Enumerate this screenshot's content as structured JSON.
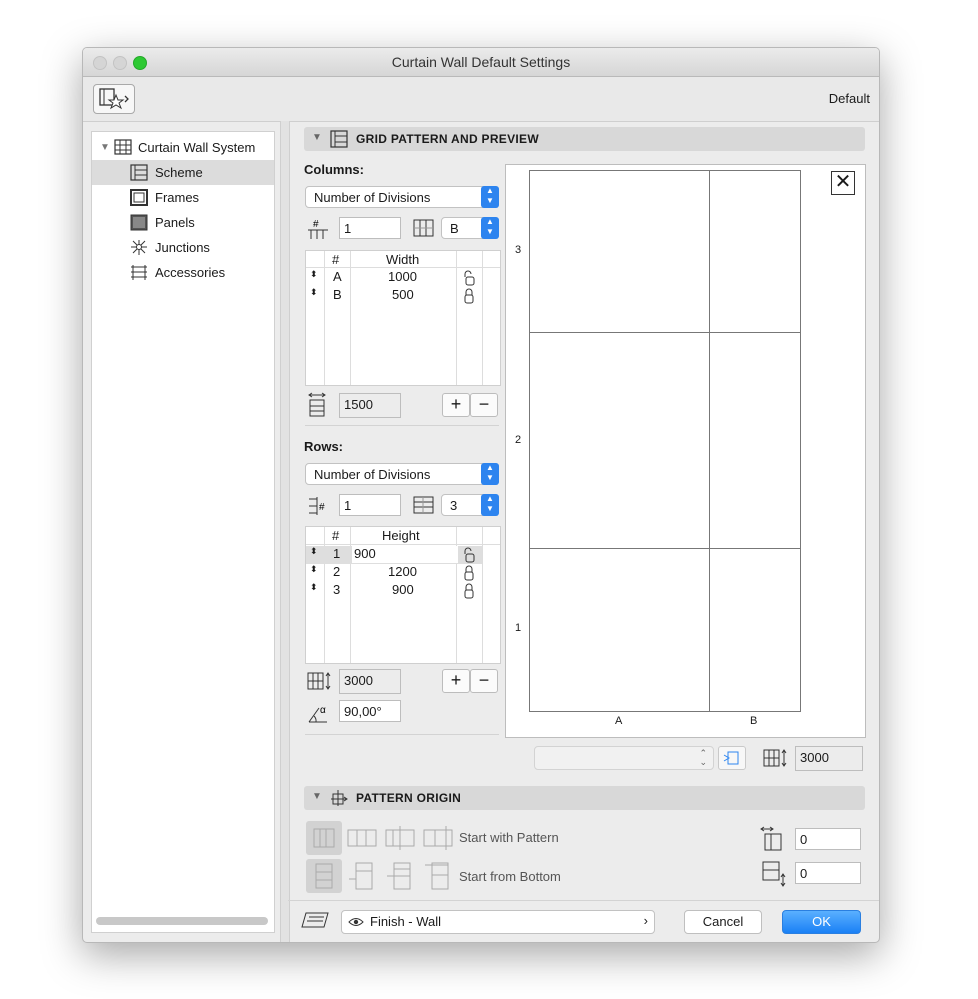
{
  "window": {
    "title": "Curtain Wall Default Settings",
    "favorites_label": "Default"
  },
  "sidebar": {
    "root": "Curtain Wall System",
    "items": [
      {
        "label": "Scheme",
        "icon": "scheme-icon",
        "selected": true
      },
      {
        "label": "Frames",
        "icon": "frames-icon"
      },
      {
        "label": "Panels",
        "icon": "panels-icon"
      },
      {
        "label": "Junctions",
        "icon": "junctions-icon"
      },
      {
        "label": "Accessories",
        "icon": "accessories-icon"
      }
    ]
  },
  "grid_section": {
    "title": "GRID PATTERN AND PREVIEW"
  },
  "columns": {
    "label": "Columns:",
    "mode": "Number of Divisions",
    "count": "1",
    "pattern": "B",
    "headers": [
      "#",
      "Width"
    ],
    "rows": [
      {
        "id": "A",
        "value": "1000",
        "lock": "unlocked"
      },
      {
        "id": "B",
        "value": "500",
        "lock": "locked"
      }
    ],
    "total": "1500"
  },
  "rows": {
    "label": "Rows:",
    "mode": "Number of Divisions",
    "count": "1",
    "pattern": "3",
    "headers": [
      "#",
      "Height"
    ],
    "rows": [
      {
        "id": "1",
        "value": "900",
        "lock": "unlocked",
        "editing": true
      },
      {
        "id": "2",
        "value": "1200",
        "lock": "locked"
      },
      {
        "id": "3",
        "value": "900",
        "lock": "locked"
      }
    ],
    "total": "3000",
    "angle": "90,00°"
  },
  "preview": {
    "row_labels": [
      "3",
      "2",
      "1"
    ],
    "col_labels": [
      "A",
      "B"
    ],
    "height_value": "3000"
  },
  "origin_section": {
    "title": "PATTERN ORIGIN",
    "start_pattern": "Start with Pattern",
    "start_bottom": "Start from Bottom",
    "offset_x": "0",
    "offset_y": "0"
  },
  "footer": {
    "surface": "Finish - Wall",
    "cancel": "Cancel",
    "ok": "OK"
  },
  "colors": {
    "accent": "#2d84ef",
    "close_green": "#2ec933"
  }
}
